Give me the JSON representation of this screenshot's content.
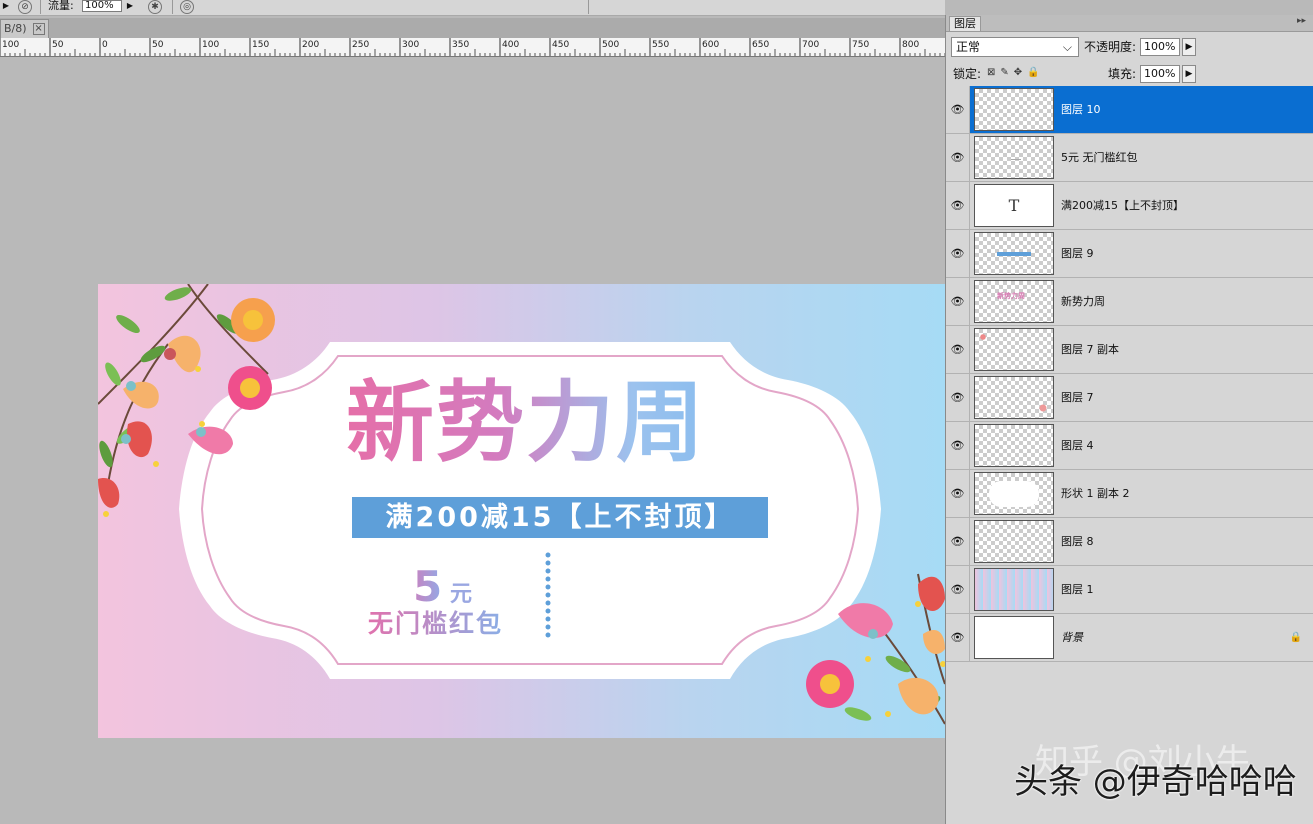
{
  "options_bar": {
    "flow_label": "流量:",
    "flow_value": "100%"
  },
  "document_tab": {
    "title": "B/8)",
    "close": "×"
  },
  "ruler": {
    "labels": [
      "100",
      "50",
      "0",
      "50",
      "100",
      "150",
      "200",
      "250",
      "300",
      "350",
      "400",
      "450",
      "500",
      "550",
      "600",
      "650",
      "700",
      "750",
      "800"
    ]
  },
  "banner": {
    "headline": "新势力周",
    "offer": "满200减15【上不封顶】",
    "amount": "5",
    "unit": "元",
    "coupon": "无门槛红包",
    "colors": {
      "pink": "#e56fa8",
      "blue": "#5e9fd9",
      "light_blue": "#a6dbf5"
    }
  },
  "layers_panel": {
    "title": "图层",
    "blend_mode": "正常",
    "opacity_label": "不透明度:",
    "opacity": "100%",
    "lock_label": "锁定:",
    "fill_label": "填充:",
    "fill": "100%",
    "layers": [
      {
        "name": "图层 10",
        "selected": true
      },
      {
        "name": "5元 无门槛红包"
      },
      {
        "name": "满200减15【上不封顶】"
      },
      {
        "name": "图层 9"
      },
      {
        "name": "新势力周"
      },
      {
        "name": "图层 7 副本"
      },
      {
        "name": "图层 7"
      },
      {
        "name": "图层 4"
      },
      {
        "name": "形状 1 副本 2"
      },
      {
        "name": "图层 8"
      },
      {
        "name": "图层 1"
      },
      {
        "name": "背景"
      }
    ]
  },
  "watermark": {
    "line1": "知乎 @刘小牛",
    "line2": "头条 @伊奇哈哈哈"
  }
}
